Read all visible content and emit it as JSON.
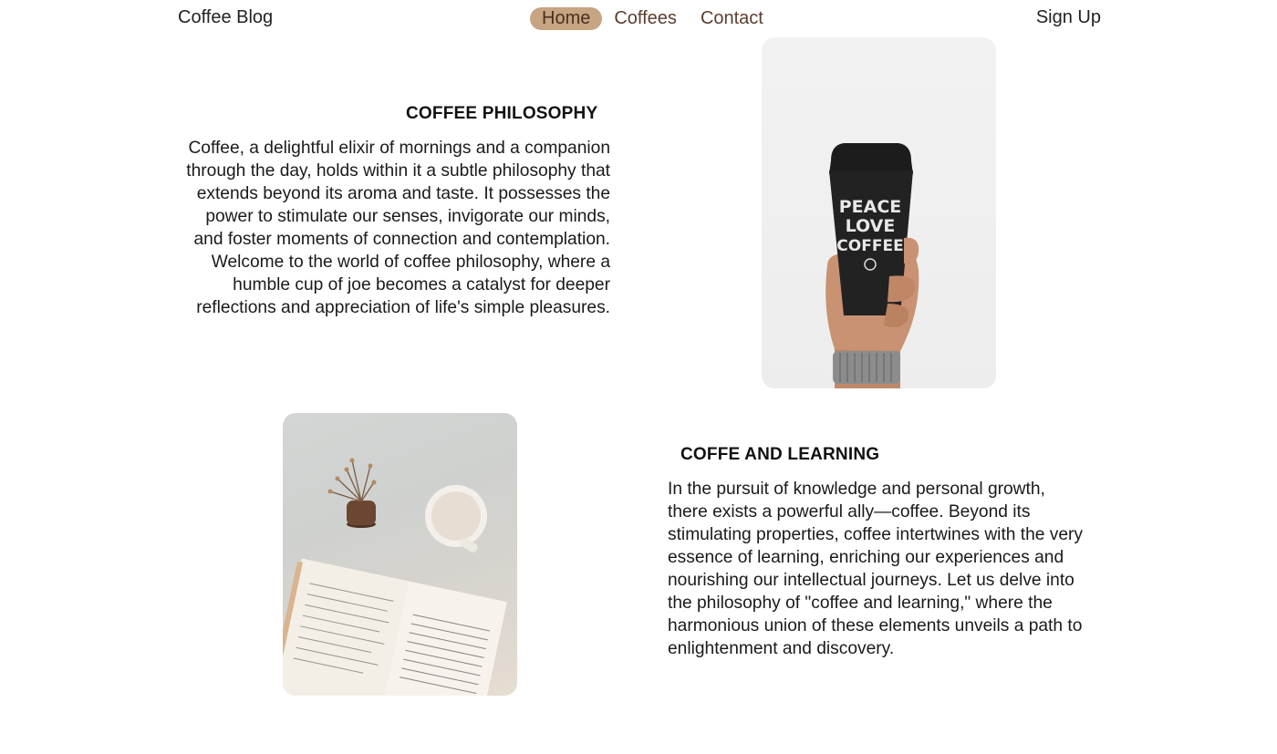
{
  "nav": {
    "brand": "Coffee Blog",
    "links": [
      "Home",
      "Coffees",
      "Contact"
    ],
    "active": "Home",
    "signup": "Sign Up"
  },
  "sections": [
    {
      "title": "COFFEE PHILOSOPHY",
      "body": "Coffee, a delightful elixir of mornings and a companion through the day, holds within it a subtle philosophy that extends beyond its aroma and taste. It possesses the power to stimulate our senses, invigorate our minds, and foster moments of connection and contemplation. Welcome to the world of coffee philosophy, where a humble cup of joe becomes a catalyst for deeper reflections and appreciation of life's simple pleasures.",
      "cup_text": [
        "PEACE",
        "LOVE",
        "COFFEE"
      ]
    },
    {
      "title": "COFFE AND LEARNING",
      "body": "In the pursuit of knowledge and personal growth, there exists a powerful ally—coffee. Beyond its stimulating properties, coffee intertwines with the very essence of learning, enriching our experiences and nourishing our intellectual journeys. Let us delve into the philosophy of \"coffee and learning,\" where the harmonious union of these elements unveils a path to enlightenment and discovery."
    }
  ],
  "colors": {
    "accent": "#c7a482",
    "link": "#5a3e2e"
  }
}
